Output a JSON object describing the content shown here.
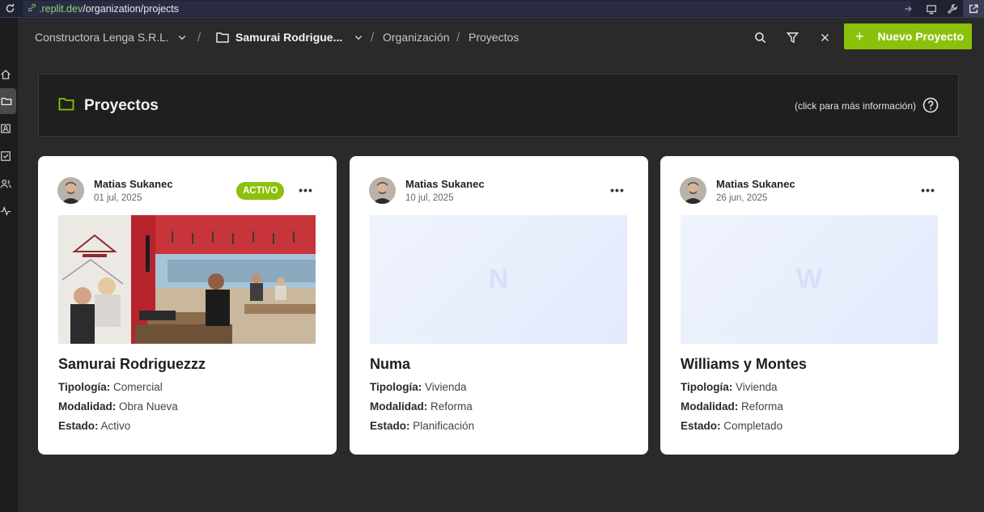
{
  "browser": {
    "url_host": ".replit.dev",
    "url_path": "/organization/projects"
  },
  "breadcrumb": {
    "org": "Constructora Lenga S.R.L.",
    "project": "Samurai Rodrigue...",
    "section": "Organización",
    "page": "Proyectos",
    "separator": "/"
  },
  "toolbar": {
    "new_project_label": "Nuevo Proyecto",
    "plus": "+"
  },
  "header": {
    "title": "Proyectos",
    "help_text": "(click para más información)"
  },
  "labels": {
    "typology": "Tipología:",
    "modality": "Modalidad:",
    "state": "Estado:"
  },
  "projects": [
    {
      "author": "Matias Sukanec",
      "date": "01 jul, 2025",
      "badge": "ACTIVO",
      "name": "Samurai Rodriguezzz",
      "typology": "Comercial",
      "modality": "Obra Nueva",
      "state": "Activo",
      "image": "restaurant-photo"
    },
    {
      "author": "Matias Sukanec",
      "date": "10 jul, 2025",
      "initial": "N",
      "name": "Numa",
      "typology": "Vivienda",
      "modality": "Reforma",
      "state": "Planificación"
    },
    {
      "author": "Matias Sukanec",
      "date": "26 jun, 2025",
      "initial": "W",
      "name": "Williams y Montes",
      "typology": "Vivienda",
      "modality": "Reforma",
      "state": "Completado"
    }
  ],
  "colors": {
    "accent": "#8cc10b",
    "background": "#2a2a2a",
    "panel": "#1f1f1f"
  }
}
